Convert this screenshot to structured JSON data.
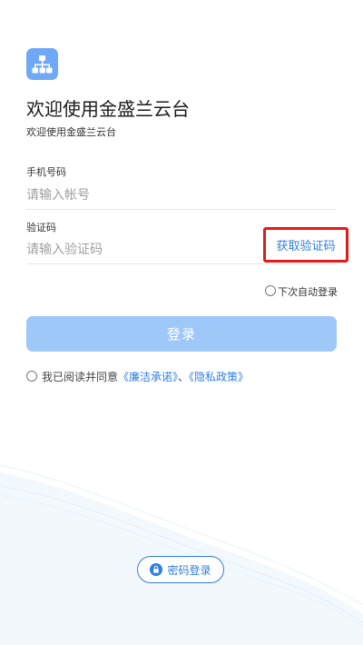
{
  "header": {
    "title": "欢迎使用金盛兰云台",
    "subtitle": "欢迎使用金盛兰云台",
    "logo_icon": "org-chart-icon"
  },
  "form": {
    "phone": {
      "label": "手机号码",
      "placeholder": "请输入帐号",
      "value": ""
    },
    "code": {
      "label": "验证码",
      "placeholder": "请输入验证码",
      "value": "",
      "get_code_label": "获取验证码"
    },
    "auto_login_label": "下次自动登录",
    "login_label": "登录"
  },
  "agreement": {
    "prefix": "我已阅读并同意",
    "link1": "《廉洁承诺》",
    "separator": "、",
    "link2": "《隐私政策》"
  },
  "footer": {
    "password_login_label": "密码登录",
    "icon": "lock-icon"
  },
  "colors": {
    "accent": "#2f7fe0",
    "login_button": "#9ec8f7",
    "highlight_border": "#e11b1b",
    "logo_bg": "#6fa9f5"
  }
}
